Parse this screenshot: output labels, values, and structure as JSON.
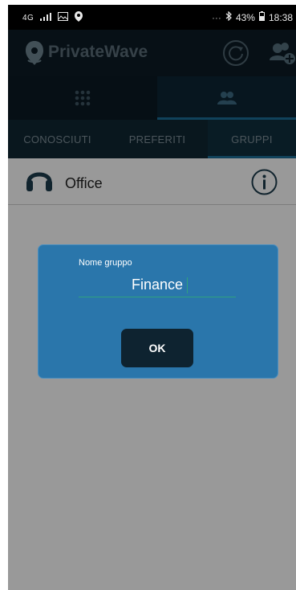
{
  "status_bar": {
    "network": "4G",
    "battery": "43%",
    "time": "18:38"
  },
  "app": {
    "title": "PrivateWave",
    "brand_color": "#5a6d78",
    "icons": {
      "logo": "privatewave-logo-icon",
      "refresh": "refresh-icon",
      "add_group": "add-group-icon"
    }
  },
  "view_tabs": [
    {
      "name": "dialpad",
      "icon": "dialpad-icon",
      "active": false
    },
    {
      "name": "contacts",
      "icon": "contacts-icon",
      "active": true
    }
  ],
  "category_tabs": [
    {
      "label": "CONOSCIUTI",
      "active": false
    },
    {
      "label": "PREFERITI",
      "active": false
    },
    {
      "label": "GRUPPI",
      "active": true
    }
  ],
  "groups": [
    {
      "name": "Office",
      "icon": "headset-icon",
      "action_icon": "info-icon"
    }
  ],
  "dialog": {
    "label": "Nome gruppo",
    "value": "Finance",
    "ok_label": "OK",
    "background": "#2a76ab"
  }
}
